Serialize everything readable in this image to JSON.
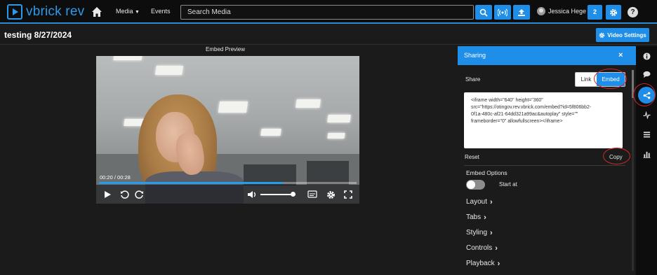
{
  "header": {
    "logo_text": "vbrick rev",
    "nav_media": "Media",
    "nav_events": "Events",
    "search_placeholder": "Search Media",
    "user_name": "Jessica Hege",
    "notification_count": "2",
    "help_label": "?"
  },
  "page": {
    "title": "testing 8/27/2024",
    "video_settings_label": "Video Settings"
  },
  "preview": {
    "label": "Embed Preview",
    "time": "00:20 / 00:28",
    "progress_fraction": 0.714,
    "volume_fraction": 0.95
  },
  "sharing": {
    "title": "Sharing",
    "close": "×",
    "share_label": "Share",
    "mode_link": "Link",
    "mode_embed": "Embed",
    "embed_code": "<iframe width=\"640\" height=\"360\"\nsrc=\"https://otingov.rev.vbrick.com/embed?id=5f806bb2-\n0f1a-480c-af21-64dd321a99ac&autoplay\" style=\"\"\nframeborder=\"0\" allowfullscreen></iframe>",
    "reset_label": "Reset",
    "copy_label": "Copy",
    "embed_options_label": "Embed Options",
    "start_at_label": "Start at",
    "options": [
      "Layout",
      "Tabs",
      "Styling",
      "Controls",
      "Playback"
    ]
  },
  "colors": {
    "accent": "#1f8ee8",
    "annotation": "#d4262a"
  },
  "rail_icons": [
    "info-icon",
    "comment-icon",
    "share-icon",
    "pulse-icon",
    "list-icon",
    "bar-chart-icon"
  ]
}
